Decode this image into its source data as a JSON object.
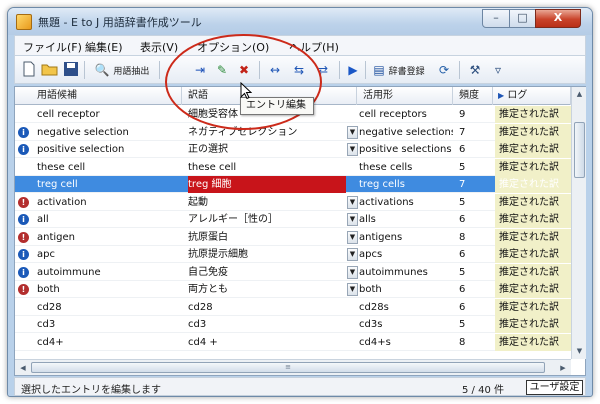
{
  "window": {
    "title": "無題 - E to J 用語辞書作成ツール"
  },
  "window_buttons": {
    "minimize": "–",
    "maximize": "□",
    "close": "X"
  },
  "menu": [
    "ファイル(F)",
    "編集(E)",
    "表示(V)",
    "オプション(O)",
    "ヘルプ(H)"
  ],
  "toolbar": {
    "term_extract_label": "用語抽出",
    "dict_register_label": "辞書登録"
  },
  "tooltip": "エントリ編集",
  "columns": {
    "term": "用語候補",
    "translation": "訳語",
    "inflected": "活用形",
    "frequency": "頻度",
    "log": "ログ"
  },
  "rows": [
    {
      "icon": "",
      "term": "cell receptor",
      "translation": "細胞受容体",
      "combo": false,
      "inflected": "cell receptors",
      "freq": "9",
      "log": "推定された訳"
    },
    {
      "icon": "info",
      "term": "negative selection",
      "translation": "ネガティブセレクション",
      "combo": true,
      "inflected": "negative selections",
      "freq": "7",
      "log": "推定された訳"
    },
    {
      "icon": "info",
      "term": "positive selection",
      "translation": "正の選択",
      "combo": true,
      "inflected": "positive selections",
      "freq": "6",
      "log": "推定された訳"
    },
    {
      "icon": "",
      "term": "these cell",
      "translation": "these cell",
      "combo": false,
      "inflected": "these cells",
      "freq": "5",
      "log": "推定された訳"
    },
    {
      "icon": "",
      "term": "treg cell",
      "translation": "treg 細胞",
      "combo": false,
      "inflected": "treg cells",
      "freq": "7",
      "log": "推定された訳",
      "selected": true
    },
    {
      "icon": "warn",
      "term": "activation",
      "translation": "起動",
      "combo": true,
      "inflected": "activations",
      "freq": "5",
      "log": "推定された訳"
    },
    {
      "icon": "info",
      "term": "all",
      "translation": "アレルギー［性の］",
      "combo": true,
      "inflected": "alls",
      "freq": "6",
      "log": "推定された訳"
    },
    {
      "icon": "warn",
      "term": "antigen",
      "translation": "抗原蛋白",
      "combo": true,
      "inflected": "antigens",
      "freq": "8",
      "log": "推定された訳"
    },
    {
      "icon": "info",
      "term": "apc",
      "translation": "抗原提示細胞",
      "combo": true,
      "inflected": "apcs",
      "freq": "6",
      "log": "推定された訳"
    },
    {
      "icon": "info",
      "term": "autoimmune",
      "translation": "自己免疫",
      "combo": true,
      "inflected": "autoimmunes",
      "freq": "5",
      "log": "推定された訳"
    },
    {
      "icon": "warn",
      "term": "both",
      "translation": "両方とも",
      "combo": true,
      "inflected": "both",
      "freq": "6",
      "log": "推定された訳"
    },
    {
      "icon": "",
      "term": "cd28",
      "translation": "cd28",
      "combo": false,
      "inflected": "cd28s",
      "freq": "6",
      "log": "推定された訳"
    },
    {
      "icon": "",
      "term": "cd3",
      "translation": "cd3",
      "combo": false,
      "inflected": "cd3s",
      "freq": "5",
      "log": "推定された訳"
    },
    {
      "icon": "",
      "term": "cd4+",
      "translation": "cd4 +",
      "combo": false,
      "inflected": "cd4+s",
      "freq": "8",
      "log": "推定された訳"
    }
  ],
  "status": {
    "message": "選択したエントリを編集します",
    "count": "5 / 40 件",
    "mode": "ユーザ設定"
  },
  "colors": {
    "selection": "#3f8be0",
    "selected_translation_bg": "#c8141a",
    "highlight_ring": "#cc2a1a"
  }
}
